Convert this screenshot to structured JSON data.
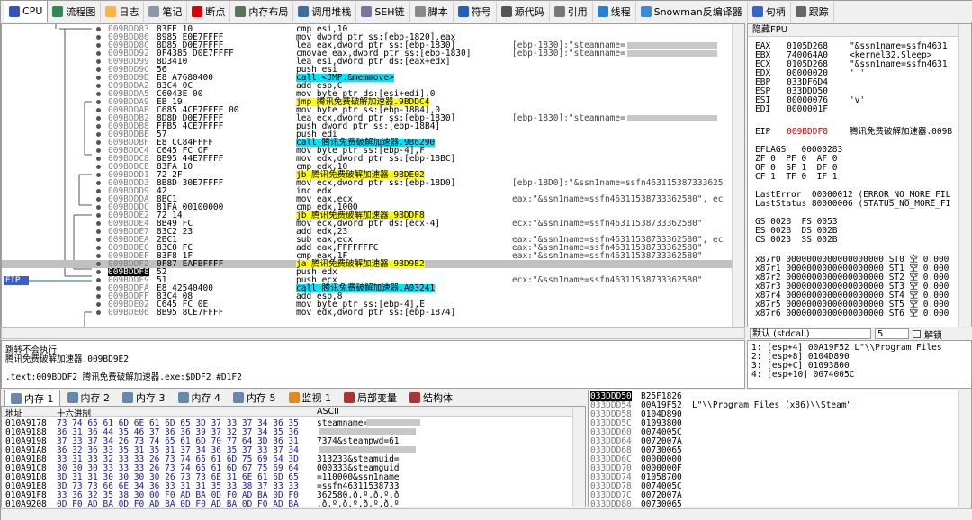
{
  "tabs": [
    {
      "label": "CPU",
      "icon": "cpu-icon",
      "color": "#3355bb"
    },
    {
      "label": "流程图",
      "icon": "graph-icon",
      "color": "#2e8b57"
    },
    {
      "label": "日志",
      "icon": "log-icon",
      "color": "#ffb347"
    },
    {
      "label": "笔记",
      "icon": "notes-icon",
      "color": "#8899aa"
    },
    {
      "label": "断点",
      "icon": "breakpoint-icon",
      "color": "#dd0000"
    },
    {
      "label": "内存布局",
      "icon": "memory-map-icon",
      "color": "#557755"
    },
    {
      "label": "调用堆栈",
      "icon": "call-stack-icon",
      "color": "#3a6ea5"
    },
    {
      "label": "SEH链",
      "icon": "seh-icon",
      "color": "#777799"
    },
    {
      "label": "脚本",
      "icon": "script-icon",
      "color": "#8a8a8a"
    },
    {
      "label": "符号",
      "icon": "symbols-icon",
      "color": "#1f5fbf"
    },
    {
      "label": "源代码",
      "icon": "source-icon",
      "color": "#555555"
    },
    {
      "label": "引用",
      "icon": "references-icon",
      "color": "#777777"
    },
    {
      "label": "线程",
      "icon": "threads-icon",
      "color": "#2a7fd4"
    },
    {
      "label": "Snowman反编译器",
      "icon": "snowman-icon",
      "color": "#3a8ad4"
    },
    {
      "label": "句柄",
      "icon": "handles-icon",
      "color": "#3366cc"
    },
    {
      "label": "跟踪",
      "icon": "trace-icon",
      "color": "#666666"
    }
  ],
  "disasm": [
    {
      "addr": "009BDD83",
      "bytes": "83FE 10",
      "asm": "cmp esi,10",
      "cmt": ""
    },
    {
      "addr": "009BDD86",
      "bytes": "8985 E0E7FFFF",
      "asm": "mov dword ptr ss:[ebp-1820],eax",
      "cmt": ""
    },
    {
      "addr": "009BDD8C",
      "bytes": "8D85 D0E7FFFF",
      "asm": "lea eax,dword ptr ss:[ebp-1830]",
      "cmt": "[ebp-1830]:\"steamname="
    },
    {
      "addr": "009BDD92",
      "bytes": "0F4385 D0E7FFFF",
      "asm": "cmovae eax,dword ptr ss:[ebp-1830]",
      "cmt": "[ebp-1830]:\"steamname="
    },
    {
      "addr": "009BDD99",
      "bytes": "8D3410",
      "asm": "lea esi,dword ptr ds:[eax+edx]",
      "cmt": ""
    },
    {
      "addr": "009BDD9C",
      "bytes": "56",
      "asm": "push esi",
      "cmt": ""
    },
    {
      "addr": "009BDD9D",
      "bytes": "E8 A7680400",
      "asm": "call <JMP.&memmove>",
      "cmt": ""
    },
    {
      "addr": "009BDDA2",
      "bytes": "83C4 0C",
      "asm": "add esp,C",
      "cmt": ""
    },
    {
      "addr": "009BDDA5",
      "bytes": "C6043E 00",
      "asm": "mov byte ptr ds:[esi+edi],0",
      "cmt": ""
    },
    {
      "addr": "009BDDA9",
      "bytes": "EB 19",
      "asm": "jmp 腾讯免费破解加速器.9BDDC4",
      "cmt": ""
    },
    {
      "addr": "009BDDAB",
      "bytes": "C685 4CE7FFFF 00",
      "asm": "mov byte ptr ss:[ebp-18B4],0",
      "cmt": ""
    },
    {
      "addr": "009BDDB2",
      "bytes": "8D8D D0E7FFFF",
      "asm": "lea ecx,dword ptr ss:[ebp-1830]",
      "cmt": "[ebp-1830]:\"steamname="
    },
    {
      "addr": "009BDDB8",
      "bytes": "FFB5 4CE7FFFF",
      "asm": "push dword ptr ss:[ebp-18B4]",
      "cmt": ""
    },
    {
      "addr": "009BDDBE",
      "bytes": "57",
      "asm": "push edi",
      "cmt": ""
    },
    {
      "addr": "009BDDBF",
      "bytes": "E8 CC84FFFF",
      "asm": "call 腾讯免费破解加速器.9B6290",
      "cmt": ""
    },
    {
      "addr": "009BDDC4",
      "bytes": "C645 FC OF",
      "asm": "mov byte ptr ss:[ebp-4],F",
      "cmt": ""
    },
    {
      "addr": "009BDDC8",
      "bytes": "8B95 44E7FFFF",
      "asm": "mov edx,dword ptr ss:[ebp-18BC]",
      "cmt": ""
    },
    {
      "addr": "009BDDCE",
      "bytes": "83FA 10",
      "asm": "cmp edx,10",
      "cmt": ""
    },
    {
      "addr": "009BDDD1",
      "bytes": "72 2F",
      "asm": "jb 腾讯免费破解加速器.9BDE02",
      "cmt": ""
    },
    {
      "addr": "009BDDD3",
      "bytes": "8B8D 30E7FFFF",
      "asm": "mov ecx,dword ptr ss:[ebp-18D0]",
      "cmt": "[ebp-18D0]:\"&ssn1name=ssfn463115387333625"
    },
    {
      "addr": "009BDDD9",
      "bytes": "42",
      "asm": "inc edx",
      "cmt": ""
    },
    {
      "addr": "009BDDDA",
      "bytes": "8BC1",
      "asm": "mov eax,ecx",
      "cmt": "eax:\"&ssn1name=ssfn46311538733362580\", ec"
    },
    {
      "addr": "009BDDDC",
      "bytes": "81FA 00100000",
      "asm": "cmp edx,1000",
      "cmt": ""
    },
    {
      "addr": "009BDDE2",
      "bytes": "72 14",
      "asm": "jb 腾讯免费破解加速器.9BDDF8",
      "cmt": ""
    },
    {
      "addr": "009BDDE4",
      "bytes": "8B49 FC",
      "asm": "mov ecx,dword ptr ds:[ecx-4]",
      "cmt": "ecx:\"&ssn1name=ssfn46311538733362580\""
    },
    {
      "addr": "009BDDE7",
      "bytes": "83C2 23",
      "asm": "add edx,23",
      "cmt": ""
    },
    {
      "addr": "009BDDEA",
      "bytes": "2BC1",
      "asm": "sub eax,ecx",
      "cmt": "eax:\"&ssn1name=ssfn46311538733362580\", ec"
    },
    {
      "addr": "009BDDEC",
      "bytes": "83C0 FC",
      "asm": "add eax,FFFFFFFC",
      "cmt": "eax:\"&ssn1name=ssfn46311538733362580\""
    },
    {
      "addr": "009BDDEF",
      "bytes": "83F8 1F",
      "asm": "cmp eax,1F",
      "cmt": "eax:\"&ssn1name=ssfn46311538733362580\""
    },
    {
      "addr": "009BDDF2",
      "bytes": "0F87 EAFBFFFF",
      "asm": "ja 腾讯免费破解加速器.9BD9E2",
      "cmt": ""
    },
    {
      "addr": "009BDDF8",
      "bytes": "52",
      "asm": "push edx",
      "cmt": ""
    },
    {
      "addr": "009BDDF9",
      "bytes": "51",
      "asm": "push ecx",
      "cmt": "ecx:\"&ssn1name=ssfn46311538733362580\""
    },
    {
      "addr": "009BDDFA",
      "bytes": "E8 42540400",
      "asm": "call 腾讯免费破解加速器.A03241",
      "cmt": ""
    },
    {
      "addr": "009BDDFF",
      "bytes": "83C4 08",
      "asm": "add esp,8",
      "cmt": ""
    },
    {
      "addr": "009BDE02",
      "bytes": "C645 FC 0E",
      "asm": "mov byte ptr ss:[ebp-4],E",
      "cmt": ""
    },
    {
      "addr": "009BDE06",
      "bytes": "8B95 8CE7FFFF",
      "asm": "mov edx,dword ptr ss:[ebp-1874]",
      "cmt": ""
    }
  ],
  "eip_label": "EIP",
  "regs": {
    "header": "隐藏FPU",
    "gp": [
      {
        "name": "EAX",
        "val": "0105D268",
        "cmt": "\"&ssn1name=ssfn4631"
      },
      {
        "name": "EBX",
        "val": "740064A0",
        "cmt": "<kernel32.Sleep>"
      },
      {
        "name": "ECX",
        "val": "0105D268",
        "cmt": "\"&ssn1name=ssfn4631"
      },
      {
        "name": "EDX",
        "val": "00000020",
        "cmt": "' '"
      },
      {
        "name": "EBP",
        "val": "033DF6D4",
        "cmt": ""
      },
      {
        "name": "ESP",
        "val": "033DDD50",
        "cmt": ""
      },
      {
        "name": "ESI",
        "val": "00000076",
        "cmt": "'v'"
      },
      {
        "name": "EDI",
        "val": "0000001F",
        "cmt": ""
      }
    ],
    "eip": {
      "name": "EIP",
      "val": "009BDDF8",
      "cmt": "腾讯免费破解加速器.009B"
    },
    "eflags": "EFLAGS   00000283",
    "flags": [
      "ZF 0  PF 0  AF 0",
      "OF 0  SF 1  DF 0",
      "CF 1  TF 0  IF 1"
    ],
    "lasterror": "LastError  00000012 (ERROR_NO_MORE_FIL",
    "laststatus": "LastStatus 80000006 (STATUS_NO_MORE_FI",
    "segs": [
      "GS 002B  FS 0053",
      "ES 002B  DS 002B",
      "CS 0023  SS 002B"
    ],
    "fpu": [
      "x87r0 0000000000000000000 ST0 空 0.000",
      "x87r1 0000000000000000000 ST1 空 0.000",
      "x87r2 0000000000000000000 ST2 空 0.000",
      "x87r3 0000000000000000000 ST3 空 0.000",
      "x87r4 0000000000000000000 ST4 空 0.000",
      "x87r5 0000000000000000000 ST5 空 0.000",
      "x87r6 0000000000000000000 ST6 空 0.000"
    ]
  },
  "callconv": {
    "value": "默认 (stdcall)",
    "count": "5",
    "unlock_label": "解锁"
  },
  "stack_args": [
    "1: [esp+4] 00A19F52 L\"\\\\Program Files",
    "2: [esp+8] 0104D890",
    "3: [esp+C] 01093800",
    "4: [esp+10] 0074005C"
  ],
  "info": {
    "line1": "跳转不会执行",
    "line2": "腾讯免费破解加速器.009BD9E2",
    "line3": ".text:009BDDF2 腾讯免费破解加速器.exe:$DDF2 #D1F2"
  },
  "dump_tabs": [
    {
      "label": "内存 1",
      "icon": "memory-icon"
    },
    {
      "label": "内存 2",
      "icon": "memory-icon"
    },
    {
      "label": "内存 3",
      "icon": "memory-icon"
    },
    {
      "label": "内存 4",
      "icon": "memory-icon"
    },
    {
      "label": "内存 5",
      "icon": "memory-icon"
    },
    {
      "label": "监视 1",
      "icon": "watch-icon"
    },
    {
      "label": "局部变量",
      "icon": "locals-icon"
    },
    {
      "label": "结构体",
      "icon": "struct-icon"
    }
  ],
  "dump_headers": {
    "addr": "地址",
    "hex": "十六进制",
    "ascii": "ASCII"
  },
  "dump": [
    {
      "addr": "010A9178",
      "hex": "73 74 65 61 6D 6E 61 6D 65 3D 37 33 37 34 36 35",
      "ascii": "steamname="
    },
    {
      "addr": "010A9188",
      "hex": "36 31 36 44 35 46 37 36 36 39 37 32 37 34 35 36",
      "ascii": ""
    },
    {
      "addr": "010A9198",
      "hex": "37 33 37 34 26 73 74 65 61 6D 70 77 64 3D 36 31",
      "ascii": "7374&steampwd=61"
    },
    {
      "addr": "010A91A8",
      "hex": "36 32 36 33 35 31 35 31 37 34 36 35 37 33 37 34",
      "ascii": ""
    },
    {
      "addr": "010A91B8",
      "hex": "33 31 33 32 33 33 26 73 74 65 61 6D 75 69 64 3D",
      "ascii": "313233&steamuid="
    },
    {
      "addr": "010A91C8",
      "hex": "30 30 30 33 33 33 26 73 74 65 61 6D 67 75 69 64",
      "ascii": "000333&steamguid"
    },
    {
      "addr": "010A91D8",
      "hex": "3D 31 31 30 30 30 30 26 73 73 6E 31 6E 61 6D 65",
      "ascii": "=110000&ssn1name"
    },
    {
      "addr": "010A91E8",
      "hex": "3D 73 73 66 6E 34 36 33 31 31 35 33 38 37 33 33",
      "ascii": "=ssfn46311538733"
    },
    {
      "addr": "010A91F8",
      "hex": "33 36 32 35 38 30 00 F0 AD BA 0D F0 AD BA 0D F0",
      "ascii": "362580.ð.º.ð.º.ð"
    },
    {
      "addr": "010A9208",
      "hex": "0D F0 AD BA 0D F0 AD BA 0D F0 AD BA 0D F0 AD BA",
      "ascii": ".ð.º.ð.º.ð.º.ð.º"
    }
  ],
  "stack": [
    {
      "addr": "033DDD50",
      "val": "B25F1826",
      "cmt": ""
    },
    {
      "addr": "033DDD54",
      "val": "00A19F52",
      "cmt": "L\"\\\\Program Files (x86)\\\\Steam\""
    },
    {
      "addr": "033DDD58",
      "val": "0104D890",
      "cmt": ""
    },
    {
      "addr": "033DDD5C",
      "val": "01093800",
      "cmt": ""
    },
    {
      "addr": "033DDD60",
      "val": "0074005C",
      "cmt": ""
    },
    {
      "addr": "033DDD64",
      "val": "0072007A",
      "cmt": ""
    },
    {
      "addr": "033DDD68",
      "val": "00730065",
      "cmt": ""
    },
    {
      "addr": "033DDD6C",
      "val": "00000000",
      "cmt": ""
    },
    {
      "addr": "033DDD70",
      "val": "0000000F",
      "cmt": ""
    },
    {
      "addr": "033DDD74",
      "val": "01058700",
      "cmt": ""
    },
    {
      "addr": "033DDD78",
      "val": "0074005C",
      "cmt": ""
    },
    {
      "addr": "033DDD7C",
      "val": "0072007A",
      "cmt": ""
    },
    {
      "addr": "033DDD80",
      "val": "00730065",
      "cmt": ""
    }
  ]
}
